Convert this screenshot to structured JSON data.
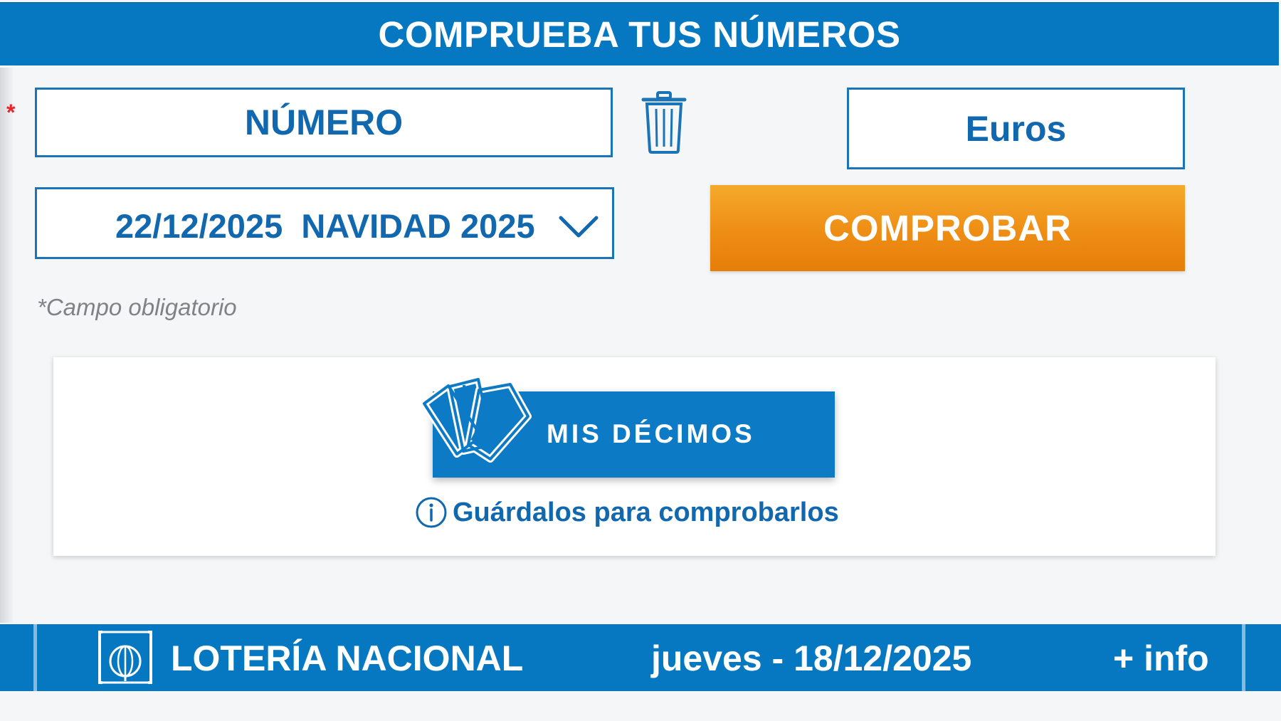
{
  "header": {
    "title": "COMPRUEBA TUS NÚMEROS"
  },
  "form": {
    "required_mark": "*",
    "number_placeholder": "NÚMERO",
    "amount_placeholder": "Euros",
    "draw_select": {
      "date": "22/12/2025",
      "name": "NAVIDAD 2025"
    },
    "submit_label": "COMPROBAR",
    "required_note": "*Campo obligatorio",
    "trash_icon": "trash-icon"
  },
  "mis_decimos": {
    "button_label": "MIS DÉCIMOS",
    "info_text": "Guárdalos para comprobarlos",
    "icon": "tickets-icon"
  },
  "footer": {
    "brand": "LOTERÍA NACIONAL",
    "date": "jueves - 18/12/2025",
    "more_link": "+ info"
  },
  "colors": {
    "primary_blue": "#0678c2",
    "text_blue": "#1168ae",
    "orange": "#ee8d14",
    "required_red": "#e8262a"
  }
}
